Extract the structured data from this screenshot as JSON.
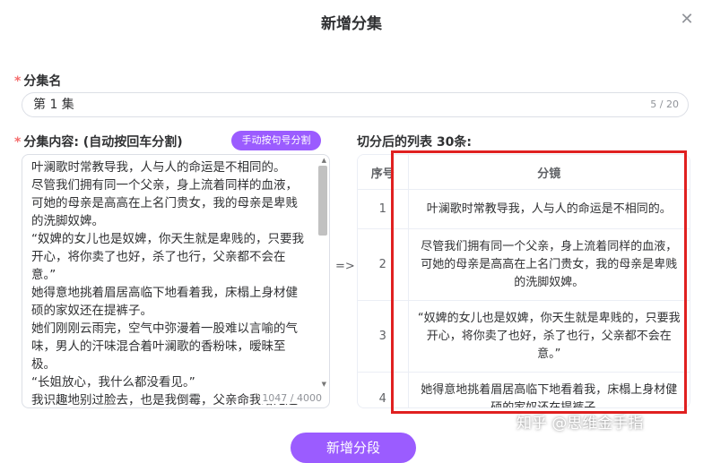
{
  "dialog": {
    "title": "新增分集",
    "close_icon": "close-icon"
  },
  "name_field": {
    "label": "分集名",
    "value": "第 1 集",
    "count": "5 / 20"
  },
  "content_field": {
    "label": "分集内容: (自动按回车分割)",
    "split_button": "手动按句号分割",
    "text": "叶澜歌时常教导我，人与人的命运是不相同的。\n尽管我们拥有同一个父亲，身上流着同样的血液，可她的母亲是高高在上名门贵女，我的母亲是卑贱的洗脚奴婢。\n“奴婢的女儿也是奴婢，你天生就是卑贱的，只要我开心，将你卖了也好，杀了也行，父亲都不会在意。”\n她得意地挑着眉居高临下地看着我，床榻上身材健硕的家奴还在提裤子。\n她们刚刚云雨完，空气中弥漫着一股难以言喻的气味，男人的汗味混合着叶澜歌的香粉味，暧昧至极。\n“长姐放心，我什么都没看见。”\n我识趣地别过脸去，也是我倒霉，父亲命我给她送新炖的燕窝，却撞破了她在闺房之中与男人苟合。\n这男人还是府上的家奴叫福安。身份同我一样低贱",
    "count": "1047 / 4000"
  },
  "arrow": "=>",
  "split_list": {
    "title": "切分后的列表 30条:",
    "columns": [
      "序号",
      "分镜"
    ],
    "rows": [
      {
        "index": "1",
        "text": "叶澜歌时常教导我，人与人的命运是不相同的。"
      },
      {
        "index": "2",
        "text": "尽管我们拥有同一个父亲，身上流着同样的血液，可她的母亲是高高在上名门贵女，我的母亲是卑贱的洗脚奴婢。"
      },
      {
        "index": "3",
        "text": "“奴婢的女儿也是奴婢，你天生就是卑贱的，只要我开心，将你卖了也好，杀了也行，父亲都不会在意。”"
      },
      {
        "index": "4",
        "text": "她得意地挑着眉居高临下地看着我，床榻上身材健硕的家奴还在提裤子。"
      }
    ]
  },
  "add_button": "新增分段",
  "watermark": "知乎 @思维金手指",
  "colors": {
    "accent": "#9b5cff",
    "highlight_box": "#e02020",
    "required": "#f56c6c"
  }
}
